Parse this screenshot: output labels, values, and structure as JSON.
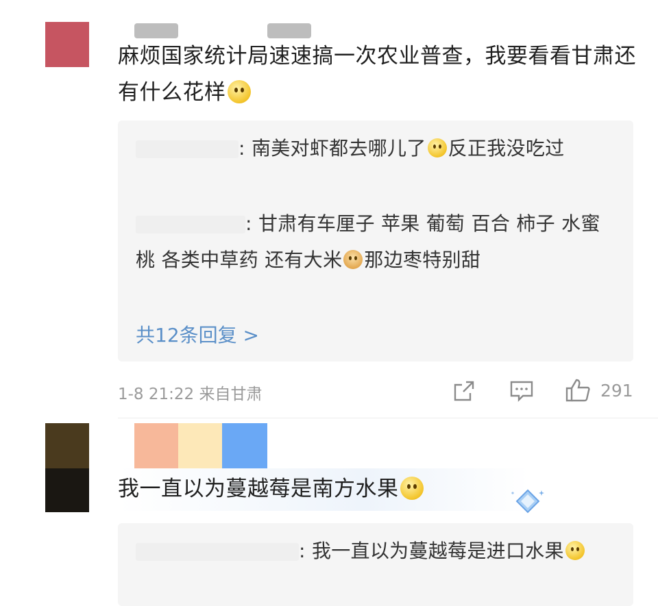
{
  "comment1": {
    "text": "麻烦国家统计局速速搞一次农业普查，我要看看甘肃还有什么花样",
    "avatar_color": "#c65561",
    "replies": [
      {
        "sep": ":",
        "text_a": "南美对虾都去哪儿了",
        "text_b": "反正我没吃过"
      },
      {
        "sep": ":",
        "text_a": "甘肃有车厘子 苹果 葡萄 百合 柿子 水蜜桃 各类中草药 还有大米",
        "text_b": "那边枣特别甜"
      }
    ],
    "more_replies": "共12条回复 >",
    "timestamp": "1-8 21:22 来自甘肃",
    "like_count": "291"
  },
  "comment2": {
    "text": "我一直以为蔓越莓是南方水果",
    "avatar_top_color": "#4a3a1e",
    "avatar_bottom_color": "#1a1712",
    "name_colors": [
      "#f7b89a",
      "#fde8b8",
      "#6aa8f5"
    ],
    "reply": {
      "sep": ":",
      "text": "我一直以为蔓越莓是进口水果"
    }
  },
  "icons": [
    "share-icon",
    "comment-icon",
    "like-icon",
    "diamond-badge-icon"
  ],
  "accent": "#5a8fc8"
}
